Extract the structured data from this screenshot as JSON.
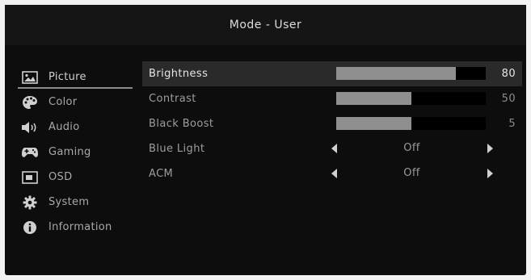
{
  "header": {
    "title": "Mode - User"
  },
  "sidebar": {
    "items": [
      {
        "label": "Picture",
        "icon": "picture-icon",
        "active": true
      },
      {
        "label": "Color",
        "icon": "palette-icon",
        "active": false
      },
      {
        "label": "Audio",
        "icon": "speaker-icon",
        "active": false
      },
      {
        "label": "Gaming",
        "icon": "gamepad-icon",
        "active": false
      },
      {
        "label": "OSD",
        "icon": "osd-icon",
        "active": false
      },
      {
        "label": "System",
        "icon": "gear-icon",
        "active": false
      },
      {
        "label": "Information",
        "icon": "info-icon",
        "active": false
      }
    ]
  },
  "settings": {
    "brightness": {
      "label": "Brightness",
      "value": "80",
      "level": 0.8
    },
    "contrast": {
      "label": "Contrast",
      "value": "50",
      "level": 0.5
    },
    "black_boost": {
      "label": "Black  Boost",
      "value": "5",
      "level": 0.5
    },
    "blue_light": {
      "label": "Blue  Light",
      "value": "Off"
    },
    "acm": {
      "label": "ACM",
      "value": "Off"
    }
  }
}
